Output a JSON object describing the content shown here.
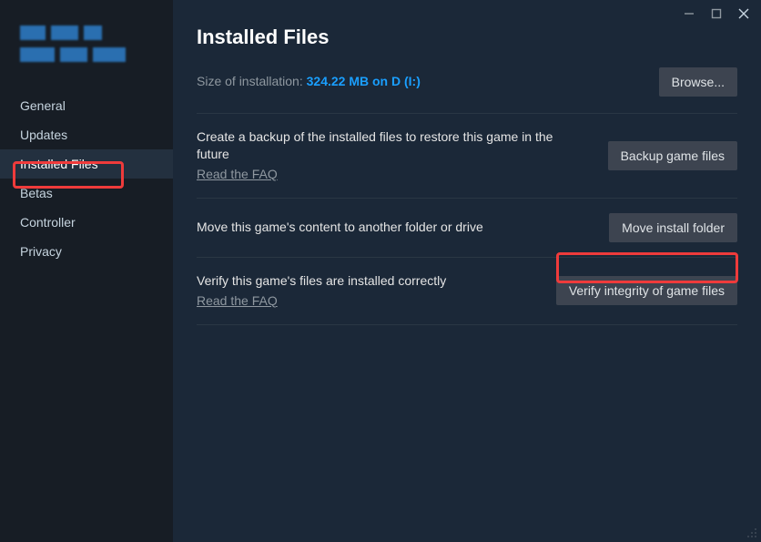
{
  "page": {
    "title": "Installed Files"
  },
  "sidebar": {
    "items": [
      {
        "label": "General"
      },
      {
        "label": "Updates"
      },
      {
        "label": "Installed Files"
      },
      {
        "label": "Betas"
      },
      {
        "label": "Controller"
      },
      {
        "label": "Privacy"
      }
    ]
  },
  "install": {
    "size_label": "Size of installation: ",
    "size_value": "324.22 MB on D (I:)",
    "browse_label": "Browse..."
  },
  "settings": {
    "backup": {
      "desc": "Create a backup of the installed files to restore this game in the future",
      "faq": "Read the FAQ",
      "button": "Backup game files"
    },
    "move": {
      "desc": "Move this game's content to another folder or drive",
      "button": "Move install folder"
    },
    "verify": {
      "desc": "Verify this game's files are installed correctly",
      "faq": "Read the FAQ",
      "button": "Verify integrity of game files"
    }
  }
}
